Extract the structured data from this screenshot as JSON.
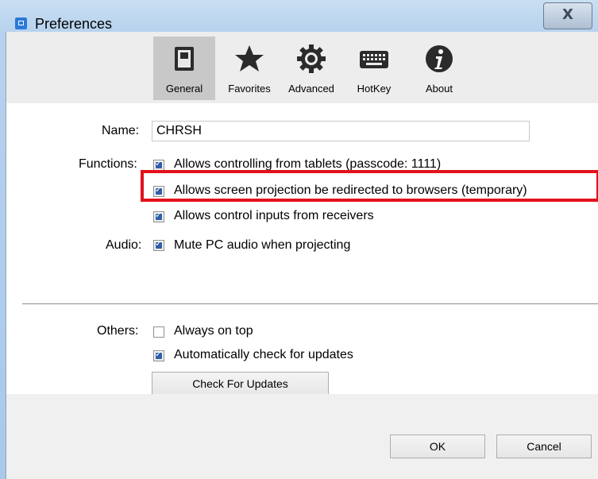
{
  "window": {
    "title": "Preferences",
    "close_glyph": "X",
    "app_icon": "app-icon"
  },
  "toolbar": {
    "tabs": [
      {
        "label": "General",
        "icon": "switch-icon",
        "selected": true
      },
      {
        "label": "Favorites",
        "icon": "star-icon",
        "selected": false
      },
      {
        "label": "Advanced",
        "icon": "gear-icon",
        "selected": false
      },
      {
        "label": "HotKey",
        "icon": "keyboard-icon",
        "selected": false
      },
      {
        "label": "About",
        "icon": "info-icon",
        "selected": false
      }
    ]
  },
  "form": {
    "name_label": "Name:",
    "name_value": "CHRSH",
    "functions_label": "Functions:",
    "functions": [
      {
        "label": "Allows controlling from tablets (passcode: 1111)",
        "checked": true
      },
      {
        "label": "Allows screen projection be redirected to browsers (temporary)",
        "checked": true
      },
      {
        "label": "Allows control inputs from receivers",
        "checked": true
      }
    ],
    "audio_label": "Audio:",
    "audio": {
      "label": "Mute PC audio when projecting",
      "checked": true
    },
    "others_label": "Others:",
    "others": [
      {
        "label": "Always on top",
        "checked": false
      },
      {
        "label": "Automatically check for updates",
        "checked": true
      }
    ],
    "check_updates_label": "Check For Updates"
  },
  "footer": {
    "ok_label": "OK",
    "cancel_label": "Cancel"
  },
  "colors": {
    "highlight": "#e3111b",
    "checkbox_fill": "#2f5fa8",
    "selected_tab": "#c8c8c8"
  }
}
